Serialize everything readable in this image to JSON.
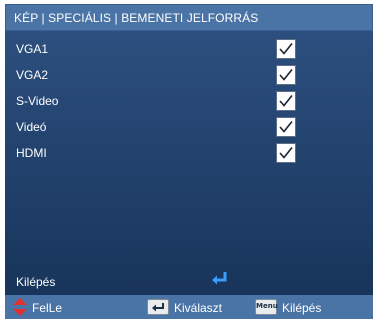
{
  "header": {
    "title": "KÉP | SPECIÁLIS | BEMENETI JELFORRÁS"
  },
  "sources": [
    {
      "label": "VGA1",
      "checked": true
    },
    {
      "label": "VGA2",
      "checked": true
    },
    {
      "label": "S-Video",
      "checked": true
    },
    {
      "label": "Videó",
      "checked": true
    },
    {
      "label": "HDMI",
      "checked": true
    }
  ],
  "exit": {
    "label": "Kilépés",
    "icon": "enter-arrow-icon"
  },
  "footer": {
    "updown": {
      "label": "FelLe",
      "icon": "up-down-arrow-icon"
    },
    "select": {
      "label": "Kiválaszt",
      "icon": "enter-key-icon"
    },
    "menu": {
      "label": "Kilépés",
      "key_text": "Menu",
      "icon": "menu-key-icon"
    }
  },
  "colors": {
    "header": "#4a73a6",
    "panel_top": "#2c4f7f",
    "panel_bottom": "#18345a",
    "accent_blue": "#3a9cff",
    "updown_red": "#e03030"
  }
}
